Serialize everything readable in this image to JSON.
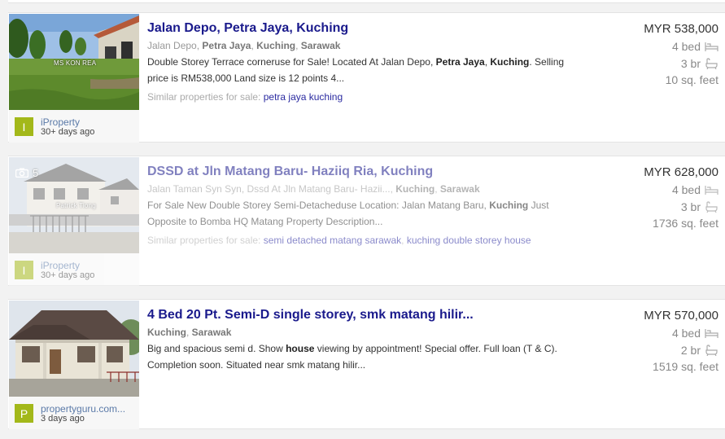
{
  "listings": [
    {
      "title": "Jalan Depo, Petra Jaya, Kuching",
      "location": {
        "street": "Jalan Depo, ",
        "area": "Petra Jaya",
        "sep1": ", ",
        "city": "Kuching",
        "sep2": ", ",
        "state": "Sarawak"
      },
      "description": {
        "p1": "Double Storey Terrace corneruse for Sale! Located At Jalan Depo, ",
        "b1": "Petra Jaya",
        "p2": ", ",
        "b2": "Kuching",
        "p3": ". Selling price is RM538,000 Land size is 12 points 4..."
      },
      "similar_label": "Similar properties for sale: ",
      "similar_links": [
        "petra jaya kuching"
      ],
      "price": "MYR 538,000",
      "beds": "4 bed",
      "baths": "3 br",
      "size": "10 sq. feet",
      "photo_watermark": "MS KON REA",
      "source": {
        "badge": "I",
        "name": "iProperty",
        "age": "30+ days ago"
      }
    },
    {
      "title": "DSSD at Jln Matang Baru- Haziiq Ria, Kuching",
      "location": {
        "street": "Jalan Taman Syn Syn, Dssd At Jln Matang Baru- Hazii..., ",
        "city": "Kuching",
        "sep2": ", ",
        "state": "Sarawak"
      },
      "description": {
        "p1": "For Sale New Double Storey Semi-Detacheduse Location: Jalan Matang Baru, ",
        "b1": "Kuching",
        "p2": " Just Opposite to Bomba HQ Matang Property Description..."
      },
      "similar_label": "Similar properties for sale: ",
      "similar_links": [
        "semi detached matang sarawak",
        "kuching double storey house"
      ],
      "price": "MYR 628,000",
      "beds": "4 bed",
      "baths": "3 br",
      "size": "1736 sq. feet",
      "photo_count": "5",
      "photo_watermark": "Patrick Tiong",
      "source": {
        "badge": "I",
        "name": "iProperty",
        "age": "30+ days ago"
      }
    },
    {
      "title": "4 Bed 20 Pt. Semi-D single storey, smk matang hilir...",
      "location": {
        "city": "Kuching",
        "sep2": ", ",
        "state": "Sarawak"
      },
      "description": {
        "p1": "Big and spacious semi d. Show ",
        "b1": "house",
        "p2": " viewing by appointment! Special offer. Full loan (T & C). Completion soon. Situated near smk matang hilir..."
      },
      "price": "MYR 570,000",
      "beds": "4 bed",
      "baths": "2 br",
      "size": "1519 sq. feet",
      "source": {
        "badge": "P",
        "name": "propertyguru.com...",
        "age": "3 days ago"
      }
    }
  ],
  "icons": {
    "bed": "bed-icon",
    "bath": "bathtub-icon",
    "camera": "camera-icon"
  },
  "colors": {
    "title": "#1a1a8c",
    "badge": "#a3b81a",
    "source_link": "#5b7aa8"
  }
}
